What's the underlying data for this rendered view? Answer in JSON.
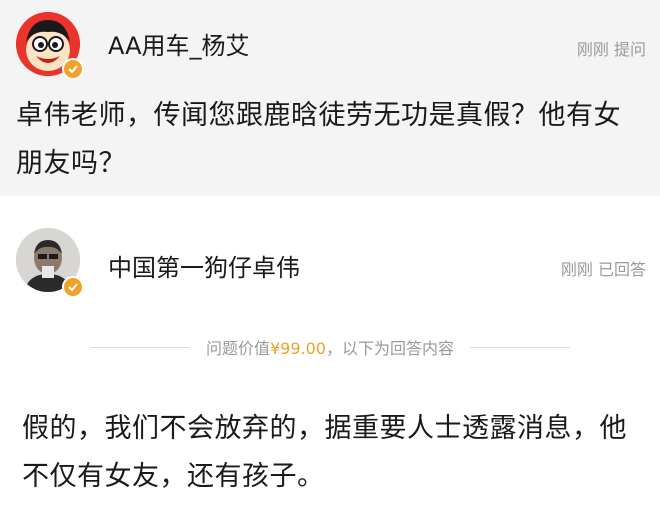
{
  "question": {
    "asker_name": "AA用车_杨艾",
    "meta": "刚刚 提问",
    "text": "卓伟老师，传闻您跟鹿晗徒劳无功是真假？他有女朋友吗？"
  },
  "answer": {
    "answerer_name": "中国第一狗仔卓伟",
    "meta": "刚刚 已回答",
    "price_prefix": "问题价值",
    "price": "¥99.00",
    "price_suffix": "，以下为回答内容",
    "text": "假的，我们不会放弃的，据重要人士透露消息，他不仅有女友，还有孩子。"
  },
  "colors": {
    "question_background": "#f4f4f4",
    "price_accent": "#f0a028",
    "verify_badge": "#f2a12a",
    "meta_text": "#9a9a9a"
  },
  "icons": [
    "cartoon-avatar-icon",
    "person-avatar-icon",
    "verified-badge-icon"
  ]
}
